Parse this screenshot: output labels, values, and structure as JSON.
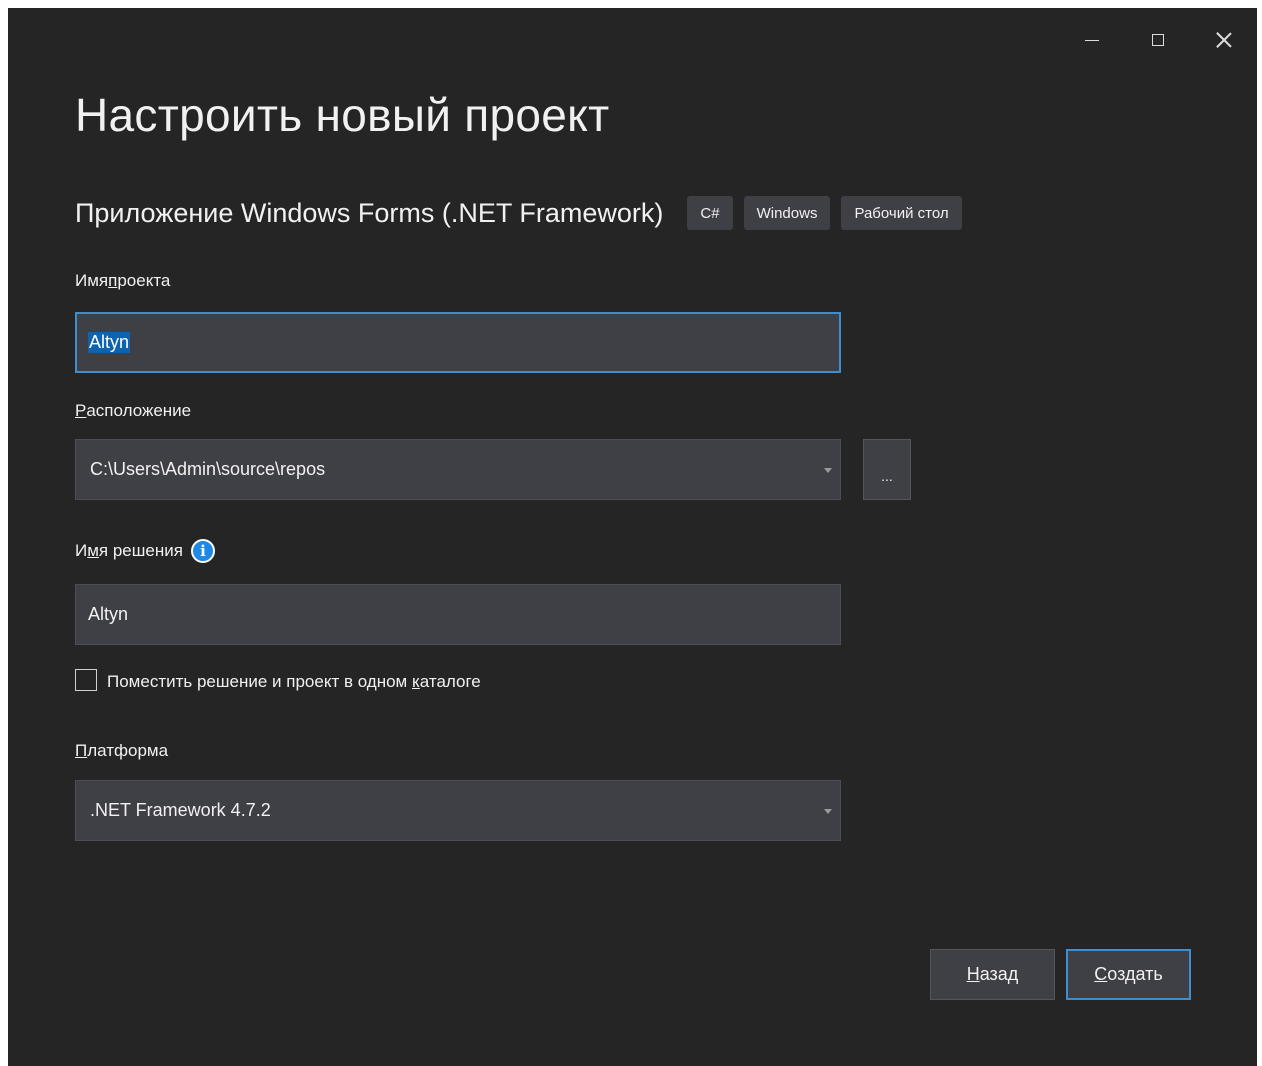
{
  "window": {
    "minimize_symbol": "–",
    "maximize_symbol": "☐",
    "close_symbol": "✕"
  },
  "title": "Настроить новый проект",
  "template": {
    "name": "Приложение Windows Forms (.NET Framework)",
    "tags": [
      "C#",
      "Windows",
      "Рабочий стол"
    ]
  },
  "project_name": {
    "label_pre": "Имя ",
    "label_key": "п",
    "label_post": "роекта",
    "value": "Altyn"
  },
  "location": {
    "label_pre": "",
    "label_key": "Р",
    "label_post": "асположение",
    "value": "C:\\Users\\Admin\\source\\repos",
    "browse_label": "..."
  },
  "solution_name": {
    "label_pre": "И",
    "label_key": "м",
    "label_post": "я решения",
    "info_icon": "i",
    "value": "Altyn"
  },
  "same_directory": {
    "label_pre": "Поместить решение и проект в одном ",
    "label_key": "к",
    "label_post": "аталоге",
    "checked": false
  },
  "platform": {
    "label_pre": "",
    "label_key": "П",
    "label_post": "латформа",
    "value": ".NET Framework 4.7.2"
  },
  "buttons": {
    "back_key": "Н",
    "back_rest": "азад",
    "create_key": "С",
    "create_rest": "оздать"
  },
  "colors": {
    "background": "#252526",
    "field": "#3f3f46",
    "accent": "#3e8ed0",
    "selection": "#0e62ae",
    "info": "#1e88e5"
  }
}
